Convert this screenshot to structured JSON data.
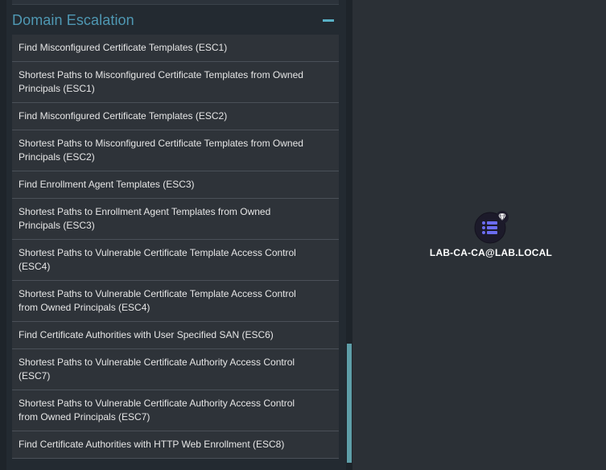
{
  "section": {
    "title": "Domain Escalation",
    "collapse_icon": "minus-icon"
  },
  "queries": [
    {
      "label": "Find Misconfigured Certificate Templates (ESC1)"
    },
    {
      "label": "Shortest Paths to Misconfigured Certificate Templates from Owned Principals (ESC1)"
    },
    {
      "label": "Find Misconfigured Certificate Templates (ESC2)"
    },
    {
      "label": "Shortest Paths to Misconfigured Certificate Templates from Owned Principals (ESC2)"
    },
    {
      "label": "Find Enrollment Agent Templates (ESC3)"
    },
    {
      "label": "Shortest Paths to Enrollment Agent Templates from Owned Principals (ESC3)"
    },
    {
      "label": "Shortest Paths to Vulnerable Certificate Template Access Control (ESC4)"
    },
    {
      "label": "Shortest Paths to Vulnerable Certificate Template Access Control from Owned Principals (ESC4)"
    },
    {
      "label": "Find Certificate Authorities with User Specified SAN (ESC6)"
    },
    {
      "label": "Shortest Paths to Vulnerable Certificate Authority Access Control (ESC7)"
    },
    {
      "label": "Shortest Paths to Vulnerable Certificate Authority Access Control from Owned Principals (ESC7)"
    },
    {
      "label": "Find Certificate Authorities with HTTP Web Enrollment (ESC8)"
    }
  ],
  "graph": {
    "node": {
      "label": "LAB-CA-CA@LAB.LOCAL",
      "icon": "list-icon",
      "badge_icon": "diamond-icon",
      "color": "#1c1a2a",
      "icon_color": "#6b6cf0"
    }
  },
  "colors": {
    "background": "#2b3036",
    "panel": "#232a31",
    "item": "#2e3339",
    "accent": "#4f98b3",
    "scrollbar": "#5e9ea8"
  }
}
